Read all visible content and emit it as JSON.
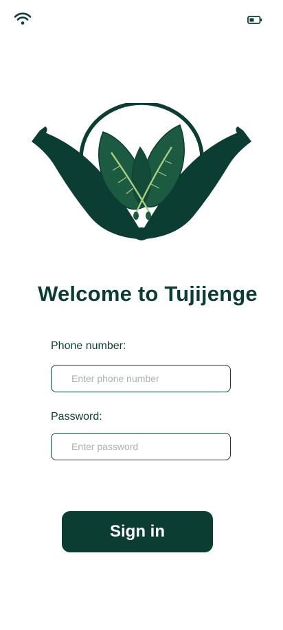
{
  "status_bar": {
    "wifi_icon": "wifi-icon",
    "battery_icon": "battery-icon"
  },
  "logo": {
    "icon": "hands-with-leaves-logo"
  },
  "welcome": {
    "title": "Welcome to Tujijenge"
  },
  "form": {
    "phone_label": "Phone number:",
    "phone_placeholder": "Enter phone number",
    "phone_value": "",
    "password_label": "Password:",
    "password_placeholder": "Enter password",
    "password_value": "",
    "signin_label": "Sign in"
  },
  "colors": {
    "brand_dark_green": "#0b3d33",
    "leaf_green": "#1c5a42",
    "stem_light_green": "#a6cf82",
    "placeholder_gray": "#a9b3b0",
    "background": "#ffffff"
  }
}
